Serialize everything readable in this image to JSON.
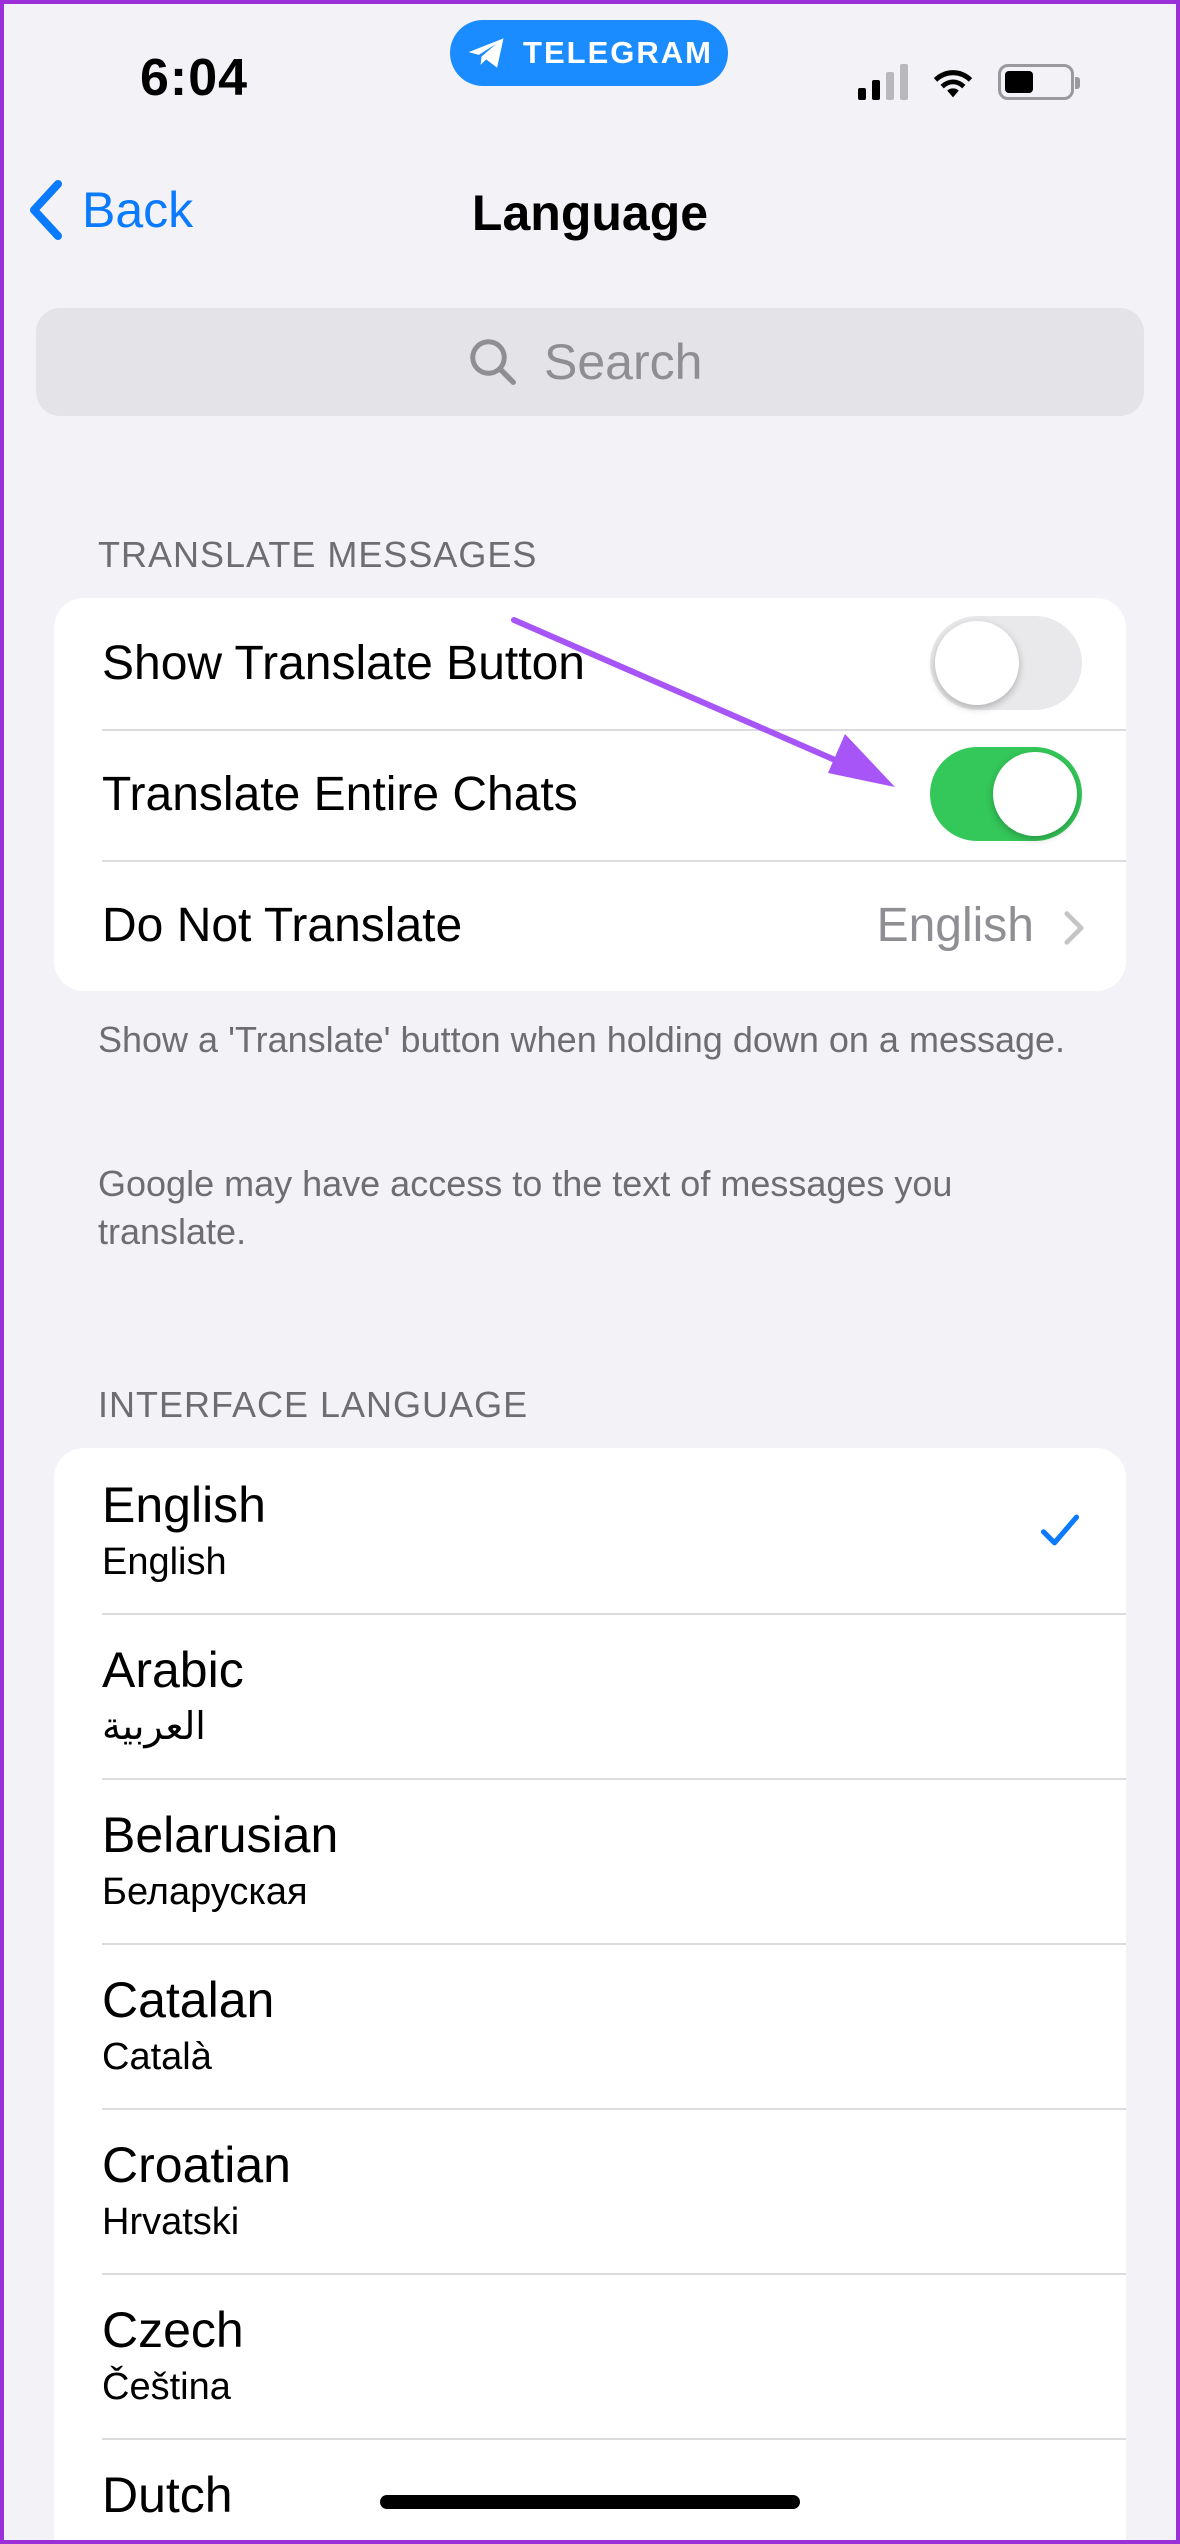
{
  "status_bar": {
    "time": "6:04",
    "app_pill": "TELEGRAM",
    "signal_bars_active": 2,
    "signal_bars_total": 4,
    "battery_level": 0.3
  },
  "nav": {
    "back_label": "Back",
    "title": "Language"
  },
  "search": {
    "placeholder": "Search"
  },
  "translate_section": {
    "header": "TRANSLATE MESSAGES",
    "rows": [
      {
        "label": "Show Translate Button",
        "toggle_on": false
      },
      {
        "label": "Translate Entire Chats",
        "toggle_on": true
      },
      {
        "label": "Do Not Translate",
        "value": "English"
      }
    ],
    "footer_1": "Show a 'Translate' button when holding down on a message.",
    "footer_2": "Google may have access to the text of messages you translate."
  },
  "interface_section": {
    "header": "INTERFACE LANGUAGE",
    "languages": [
      {
        "name": "English",
        "native": "English",
        "selected": true
      },
      {
        "name": "Arabic",
        "native": "العربية",
        "selected": false
      },
      {
        "name": "Belarusian",
        "native": "Беларуская",
        "selected": false
      },
      {
        "name": "Catalan",
        "native": "Català",
        "selected": false
      },
      {
        "name": "Croatian",
        "native": "Hrvatski",
        "selected": false
      },
      {
        "name": "Czech",
        "native": "Čeština",
        "selected": false
      },
      {
        "name": "Dutch",
        "native": "",
        "selected": false
      }
    ]
  },
  "colors": {
    "accent": "#0a7aff",
    "toggle_on": "#34c759",
    "annotation": "#a855f7",
    "frame": "#9b30d9"
  }
}
